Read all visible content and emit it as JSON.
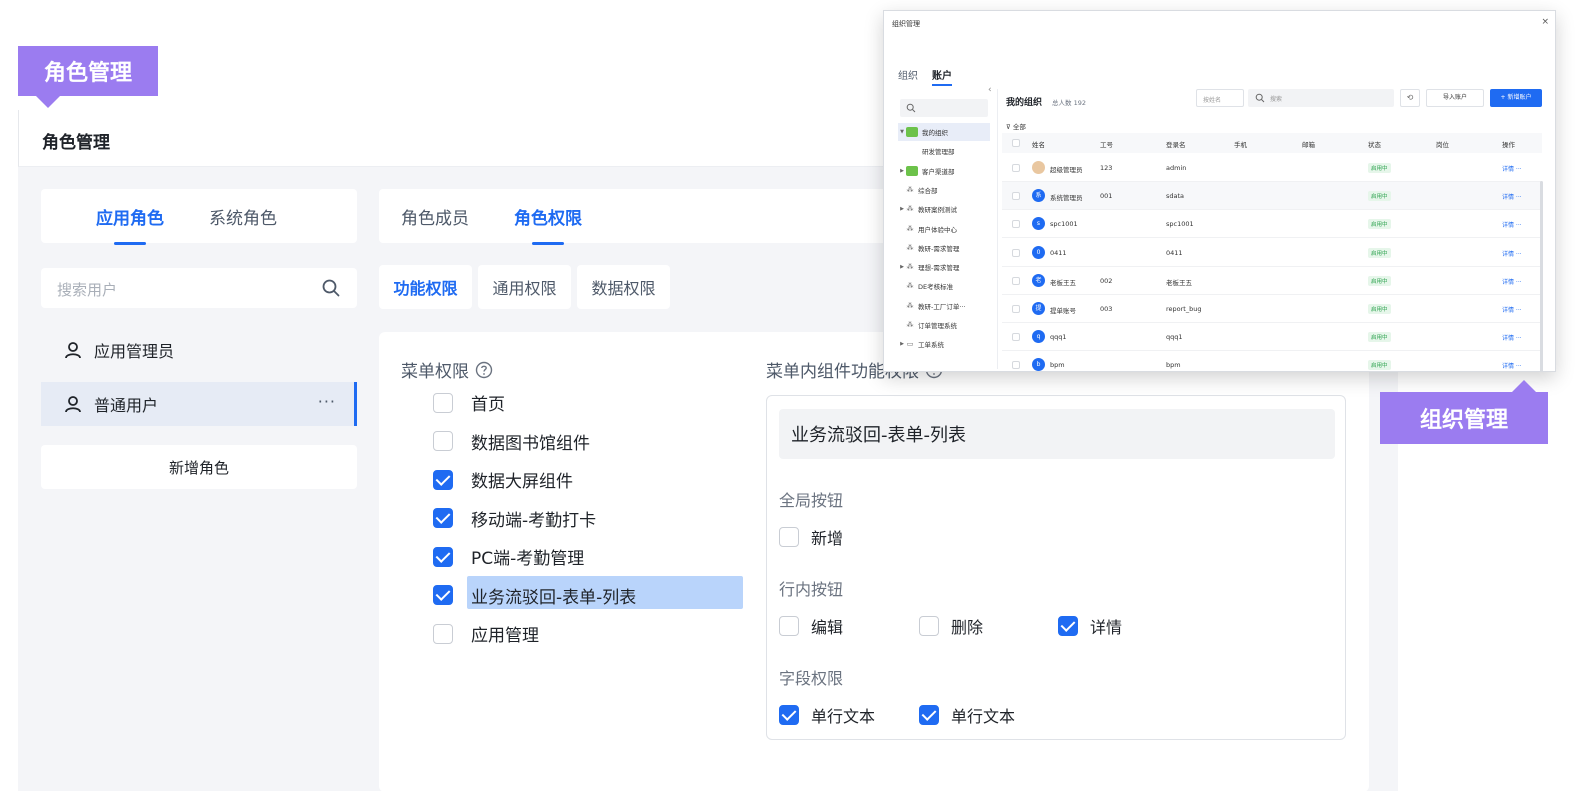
{
  "tags": {
    "role": "角色管理",
    "org": "组织管理"
  },
  "main": {
    "title": "角色管理",
    "role_tabs": [
      "应用角色",
      "系统角色"
    ],
    "search_placeholder": "搜索用户",
    "roles": [
      {
        "label": "应用管理员"
      },
      {
        "label": "普通用户",
        "more": "···"
      }
    ],
    "add_role": "新增角色",
    "detail_tabs": [
      "角色成员",
      "角色权限"
    ],
    "perm_tabs": [
      "功能权限",
      "通用权限",
      "数据权限"
    ],
    "menu_perm_title": "菜单权限",
    "menu_items": [
      {
        "label": "首页",
        "checked": false
      },
      {
        "label": "数据图书馆组件",
        "checked": false
      },
      {
        "label": "数据大屏组件",
        "checked": true
      },
      {
        "label": "移动端-考勤打卡",
        "checked": true
      },
      {
        "label": "PC端-考勤管理",
        "checked": true
      },
      {
        "label": "业务流驳回-表单-列表",
        "checked": true
      },
      {
        "label": "应用管理",
        "checked": false
      }
    ],
    "comp_perm_title": "菜单内组件功能权限",
    "comp_box": {
      "title": "业务流驳回-表单-列表",
      "global_label": "全局按钮",
      "global_items": [
        {
          "label": "新增",
          "checked": false
        }
      ],
      "row_label": "行内按钮",
      "row_items": [
        {
          "label": "编辑",
          "checked": false
        },
        {
          "label": "删除",
          "checked": false
        },
        {
          "label": "详情",
          "checked": true
        }
      ],
      "field_label": "字段权限",
      "field_items": [
        {
          "label": "单行文本",
          "checked": true
        },
        {
          "label": "单行文本",
          "checked": true
        }
      ]
    }
  },
  "org": {
    "window_title": "组织管理",
    "close": "×",
    "tabs": [
      "组织",
      "账户"
    ],
    "tree": [
      {
        "label": "我的组织",
        "arrow": "▼",
        "icon": "group",
        "sel": true
      },
      {
        "label": "研发管理部",
        "arrow": "",
        "icon": "",
        "indent": 1
      },
      {
        "label": "客户渠道部",
        "arrow": "▶",
        "icon": "group"
      },
      {
        "label": "综合部",
        "arrow": "",
        "icon": "node"
      },
      {
        "label": "教研案例测试",
        "arrow": "▶",
        "icon": "node"
      },
      {
        "label": "用户体验中心",
        "arrow": "",
        "icon": "node"
      },
      {
        "label": "教研-需求管理",
        "arrow": "",
        "icon": "node"
      },
      {
        "label": "理想-需求管理",
        "arrow": "▶",
        "icon": "node"
      },
      {
        "label": "DE考核标准",
        "arrow": "",
        "icon": "node"
      },
      {
        "label": "教研-工厂订单···",
        "arrow": "",
        "icon": "node"
      },
      {
        "label": "订单管理系统",
        "arrow": "",
        "icon": "node"
      },
      {
        "label": "工单系统",
        "arrow": "▶",
        "icon": "folder"
      }
    ],
    "main_title": "我的组织",
    "total": "总人数 192",
    "select_placeholder": "按姓名",
    "search_placeholder": "搜索",
    "import_btn": "导入账户",
    "add_btn": "+ 新增账户",
    "filter": "全部",
    "columns": [
      "姓名",
      "工号",
      "登录名",
      "手机",
      "邮箱",
      "状态",
      "岗位",
      "操作"
    ],
    "rows": [
      {
        "avatar": "",
        "name": "超级管理员",
        "id": "123",
        "login": "admin",
        "status": "启用中",
        "op": "详情 ···",
        "photo": true
      },
      {
        "avatar": "系",
        "name": "系统管理员",
        "id": "001",
        "login": "sdata",
        "status": "启用中",
        "op": "详情 ···"
      },
      {
        "avatar": "s",
        "name": "spc1001",
        "id": "",
        "login": "spc1001",
        "status": "启用中",
        "op": "详情 ···"
      },
      {
        "avatar": "0",
        "name": "0411",
        "id": "",
        "login": "0411",
        "status": "启用中",
        "op": "详情 ···"
      },
      {
        "avatar": "老",
        "name": "老板王五",
        "id": "002",
        "login": "老板王五",
        "status": "启用中",
        "op": "详情 ···"
      },
      {
        "avatar": "提",
        "name": "提单账号",
        "id": "003",
        "login": "report_bug",
        "status": "启用中",
        "op": "详情 ···"
      },
      {
        "avatar": "q",
        "name": "qqq1",
        "id": "",
        "login": "qqq1",
        "status": "启用中",
        "op": "详情 ···"
      },
      {
        "avatar": "b",
        "name": "bpm",
        "id": "",
        "login": "bpm",
        "status": "启用中",
        "op": "详情 ···"
      }
    ]
  },
  "colors": {
    "accent": "#1f6bf2",
    "tag": "#9b7cf0",
    "highlight": "#b9d4fb"
  }
}
